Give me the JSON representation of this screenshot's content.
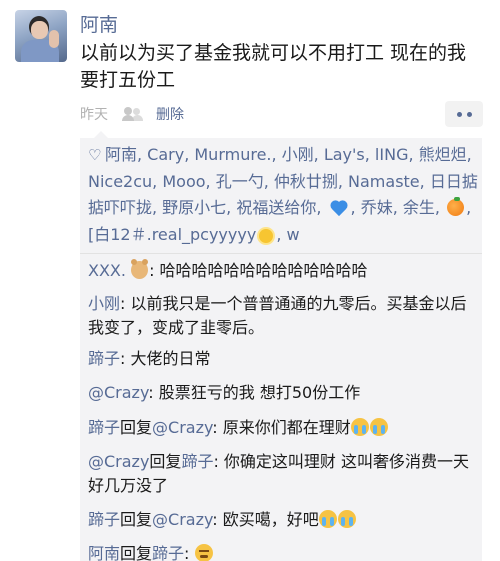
{
  "post": {
    "author": "阿南",
    "content": "以前以为买了基金我就可以不用打工 现在的我要打五份工",
    "time": "昨天",
    "delete_label": "删除",
    "visibility_icon": "friends-visibility-icon",
    "more_icon": "more-dots-icon"
  },
  "likes": {
    "heart_icon": "♡",
    "text_1": "阿南, Cary, Murmure., 小刚, Lay's, lING, 熊炟炟, Nice2cu, Mooo, 孔一勺, 仲秋廿捌, Namaste, 日日掂掂吓吓拢, 野原小七, 祝福送给你, ",
    "text_2": ", 乔妹, 余生, ",
    "text_3": ", [白12＃.real_pcyyyyy",
    "text_4": ", w"
  },
  "comments": [
    {
      "name": "XXX.",
      "text": ": 哈哈哈哈哈哈哈哈哈哈哈哈哈"
    },
    {
      "name": "小刚",
      "text": ": 以前我只是一个普普通通的九零后。买基金以后我变了，变成了韭零后。"
    },
    {
      "name": "蹄子",
      "text": ": 大佬的日常"
    },
    {
      "name": "@Crazy",
      "text": ": 股票狂亏的我  想打50份工作"
    },
    {
      "name": "蹄子",
      "reply_word": "回复",
      "reply_to": "@Crazy",
      "text": ": 原来你们都在理财"
    },
    {
      "name": "@Crazy",
      "reply_word": "回复",
      "reply_to": "蹄子",
      "text": ": 你确定这叫理财 这叫奢侈消费一天好几万没了"
    },
    {
      "name": "蹄子",
      "reply_word": "回复",
      "reply_to": "@Crazy",
      "text": ": 欧买噶，好吧"
    },
    {
      "name": "阿南",
      "reply_word": "回复",
      "reply_to": "蹄子",
      "text": ": "
    }
  ],
  "colors": {
    "link": "#576b95",
    "text": "#1a1a1a",
    "meta": "#b2b2b2",
    "panel": "#f3f3f5"
  }
}
